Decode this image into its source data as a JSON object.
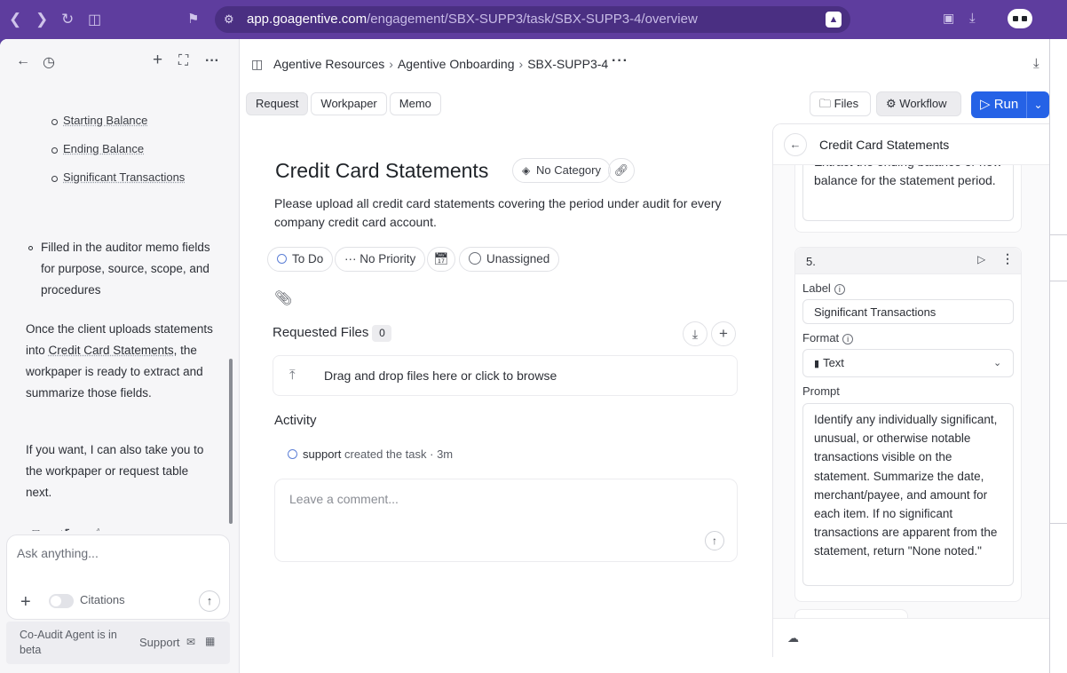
{
  "browser": {
    "url_domain": "app.goagentive.com",
    "url_path": "/engagement/SBX-SUPP3/task/SBX-SUPP3-4/overview"
  },
  "chat": {
    "sub_items": [
      "Starting Balance",
      "Ending Balance",
      "Significant Transactions"
    ],
    "bullet_text": "Filled in the auditor memo fields for purpose, source, scope, and procedures",
    "para1_before": "Once the client uploads statements into ",
    "para1_mark": "Credit Card Statements",
    "para1_after": ", the workpaper is ready to extract and summarize those fields.",
    "para2": "If you want, I can also take you to the workpaper or request table next.",
    "input_placeholder": "Ask anything...",
    "citations_label": "Citations",
    "beta_text": "Co-Audit Agent is in beta",
    "support_label": "Support"
  },
  "breadcrumb": {
    "items": [
      "Agentive Resources",
      "Agentive Onboarding",
      "SBX-SUPP3-4"
    ]
  },
  "tabs": [
    "Request",
    "Workpaper",
    "Memo"
  ],
  "actions": {
    "files": "Files",
    "workflow": "Workflow",
    "run": "Run"
  },
  "task": {
    "title": "Credit Card Statements",
    "category": "No Category",
    "description": "Please upload all credit card statements covering the period under audit for every company credit card account.",
    "status": "To Do",
    "priority": "No Priority",
    "assignee": "Unassigned"
  },
  "requested_files": {
    "header": "Requested Files",
    "count": "0",
    "drop_text": "Drag and drop files here or click to browse"
  },
  "activity": {
    "header": "Activity",
    "user": "support",
    "action": "created the task",
    "time": "3m",
    "comment_placeholder": "Leave a comment..."
  },
  "workflow_panel": {
    "title": "Credit Card Statements",
    "prev_prompt": "Extract the ending balance or new balance for the statement period.",
    "step_number": "5.",
    "label_title": "Label",
    "label_value": "Significant Transactions",
    "format_title": "Format",
    "format_value": "Text",
    "prompt_title": "Prompt",
    "prompt_value": "Identify any individually significant, unusual, or otherwise notable transactions visible on the statement. Summarize the date, merchant/payee, and amount for each item. If no significant transactions are apparent from the statement, return \"None noted.\""
  },
  "colors": {
    "accent": "#2562e6",
    "browser_frame": "#5e3d9e",
    "status_ring": "#5c7fd6"
  }
}
